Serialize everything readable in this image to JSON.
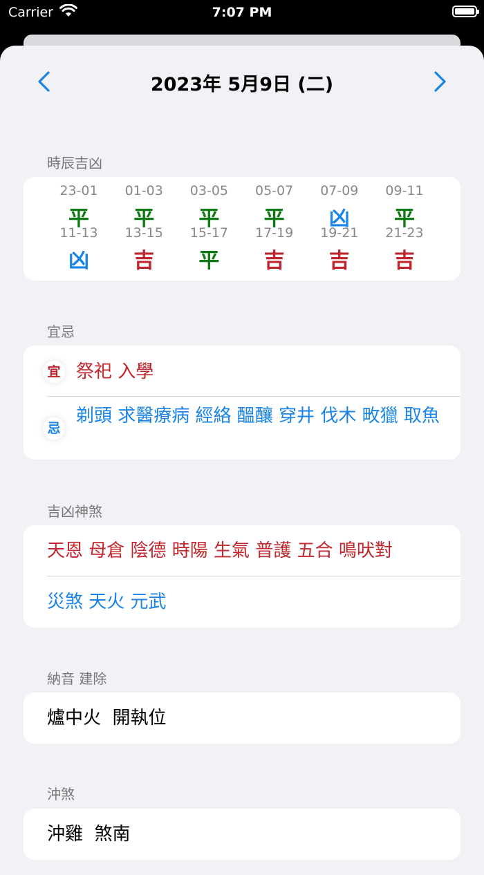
{
  "status_bar": {
    "carrier": "Carrier",
    "time": "7:07 PM"
  },
  "header": {
    "title": "2023年 5月9日 (二)"
  },
  "colors": {
    "green": "#0f7a14",
    "red": "#c0262d",
    "blue": "#1a84e6"
  },
  "hours": {
    "title": "時辰吉凶",
    "items": [
      {
        "range": "23-01",
        "status": "平"
      },
      {
        "range": "01-03",
        "status": "平"
      },
      {
        "range": "03-05",
        "status": "平"
      },
      {
        "range": "05-07",
        "status": "平"
      },
      {
        "range": "07-09",
        "status": "凶"
      },
      {
        "range": "09-11",
        "status": "平"
      },
      {
        "range": "11-13",
        "status": "凶"
      },
      {
        "range": "13-15",
        "status": "吉"
      },
      {
        "range": "15-17",
        "status": "平"
      },
      {
        "range": "17-19",
        "status": "吉"
      },
      {
        "range": "19-21",
        "status": "吉"
      },
      {
        "range": "21-23",
        "status": "吉"
      }
    ]
  },
  "yiji": {
    "title": "宜忌",
    "yi_label": "宜",
    "yi_text": "祭祀 入學",
    "ji_label": "忌",
    "ji_text": "剃頭 求醫療病 經絡 醞釀 穿井 伐木 畋獵 取魚"
  },
  "shensha": {
    "title": "吉凶神煞",
    "good": "天恩 母倉 陰德 時陽 生氣 普護 五合 鳴吠對",
    "bad": "災煞 天火 元武"
  },
  "nayin": {
    "title": "納音 建除",
    "text": "爐中火  開執位"
  },
  "chongsha": {
    "title": "沖煞",
    "text": "沖雞  煞南"
  }
}
